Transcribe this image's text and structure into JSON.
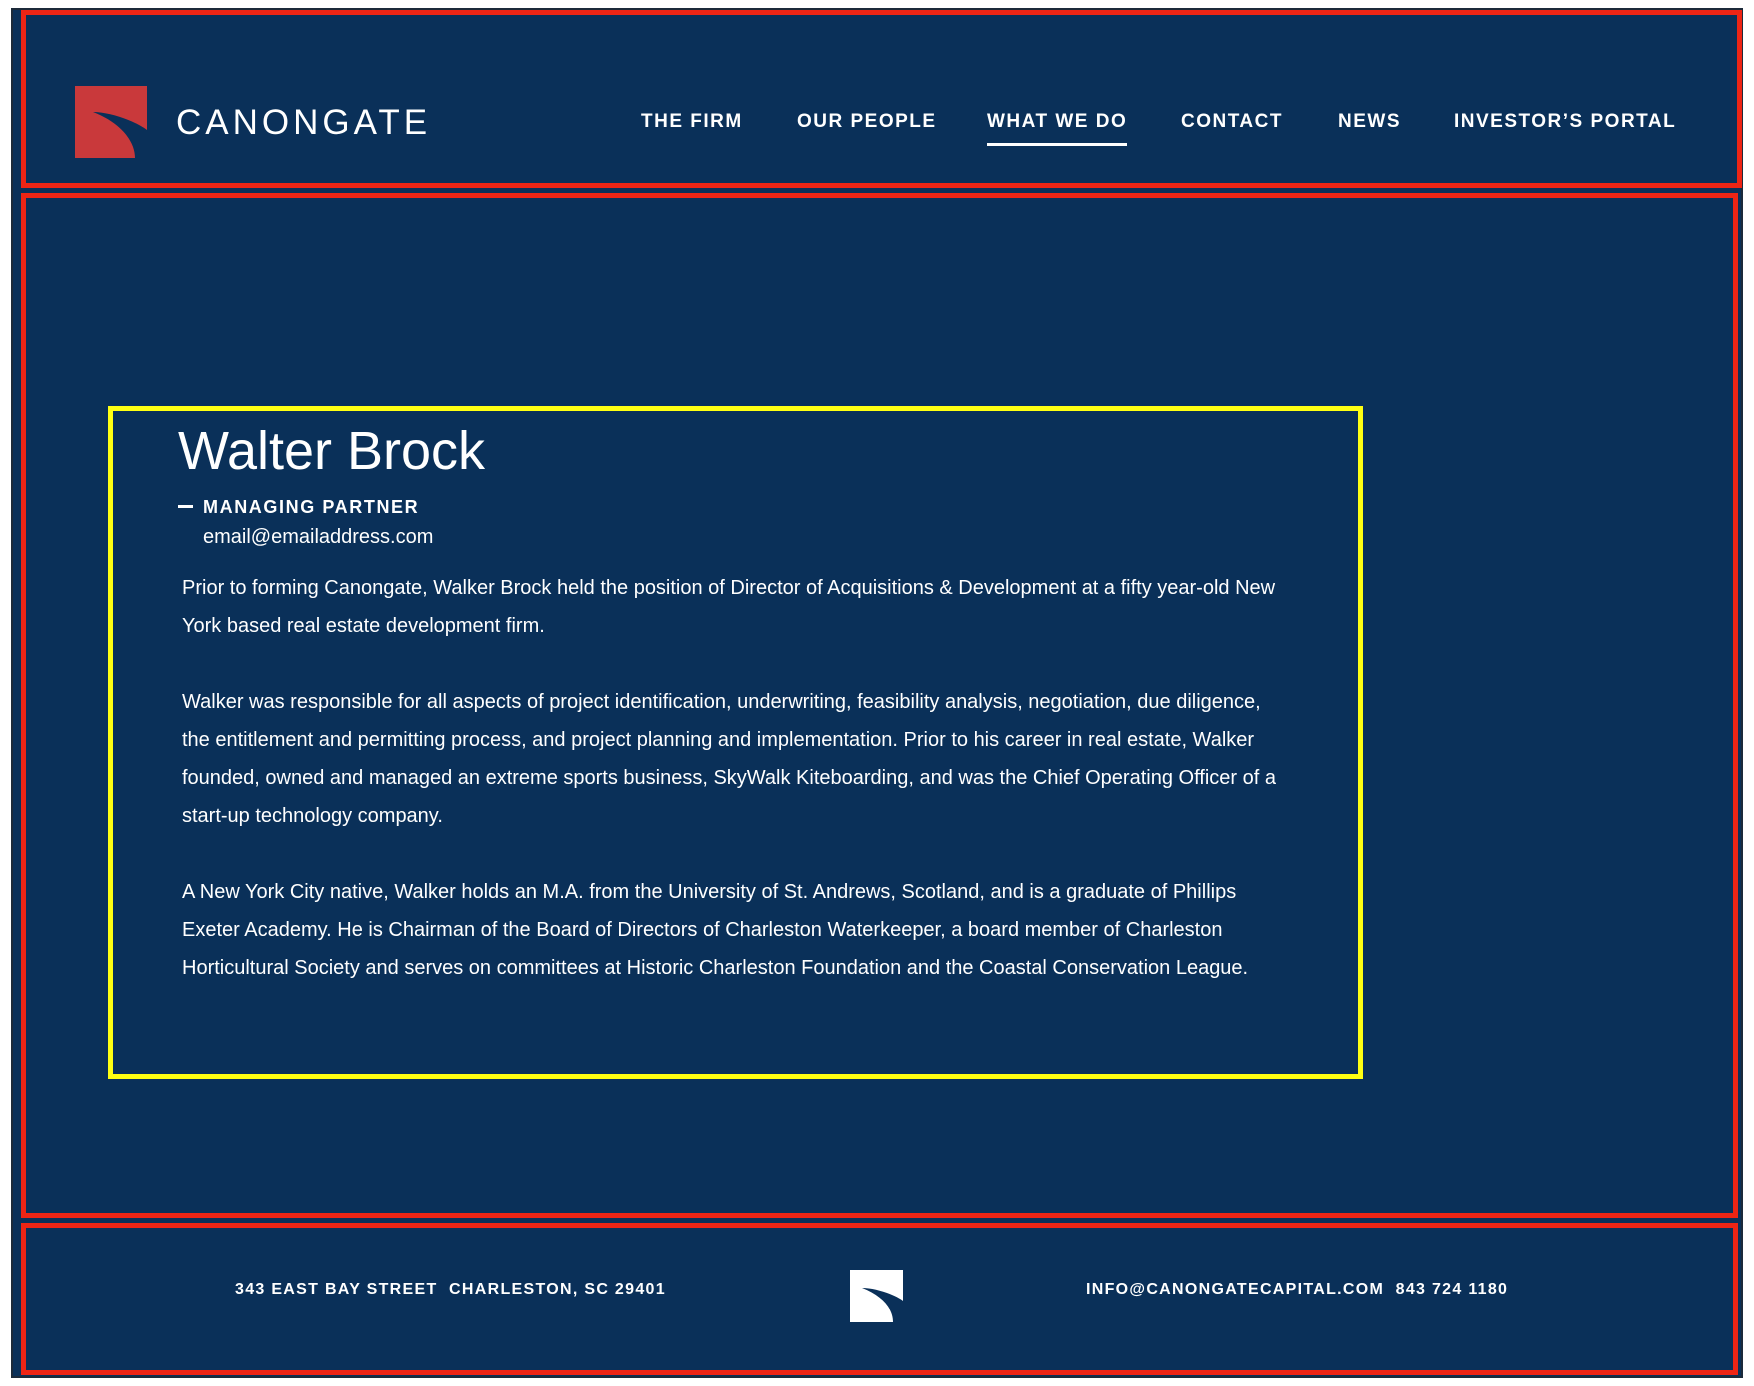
{
  "header": {
    "brand": "CANONGATE",
    "nav": [
      {
        "label": "THE FIRM",
        "active": false
      },
      {
        "label": "OUR PEOPLE",
        "active": false
      },
      {
        "label": "WHAT WE DO",
        "active": true
      },
      {
        "label": "CONTACT",
        "active": false
      },
      {
        "label": "NEWS",
        "active": false
      },
      {
        "label": "INVESTOR’S PORTAL",
        "active": false
      }
    ]
  },
  "bio": {
    "name": "Walter Brock",
    "title": "MANAGING PARTNER",
    "email": "email@emailaddress.com",
    "paragraphs": [
      "Prior to forming Canongate, Walker Brock held the position of Director of Acquisitions & Development at a fifty year-old New York based real estate development firm.",
      "Walker was responsible for all aspects of project identification, underwriting, feasibility analysis, negotiation, due diligence, the entitlement and permitting process, and project planning and implementation. Prior to his career in real estate, Walker founded, owned and managed an extreme sports business, SkyWalk Kiteboarding, and was the Chief Operating Officer of a start-up technology company.",
      "A New York City native, Walker holds an M.A. from the University of St. Andrews, Scotland, and is a graduate of Phillips Exeter Academy. He is Chairman of the Board of Directors of Charleston Waterkeeper, a board member of Charleston Horticultural Society and serves on committees at Historic Charleston Foundation and the Coastal Conservation League."
    ]
  },
  "footer": {
    "address": "343 EAST BAY STREET  CHARLESTON, SC 29401",
    "contact": "INFO@CANONGATECAPITAL.COM  843 724 1180"
  },
  "colors": {
    "background": "#0a3059",
    "logo_red": "#c9393b",
    "annotation_red": "#ee2515",
    "annotation_yellow": "#ffff12"
  },
  "icons": {
    "logo": "canongate-logo-icon",
    "footer_logo": "canongate-footer-logo-icon"
  }
}
